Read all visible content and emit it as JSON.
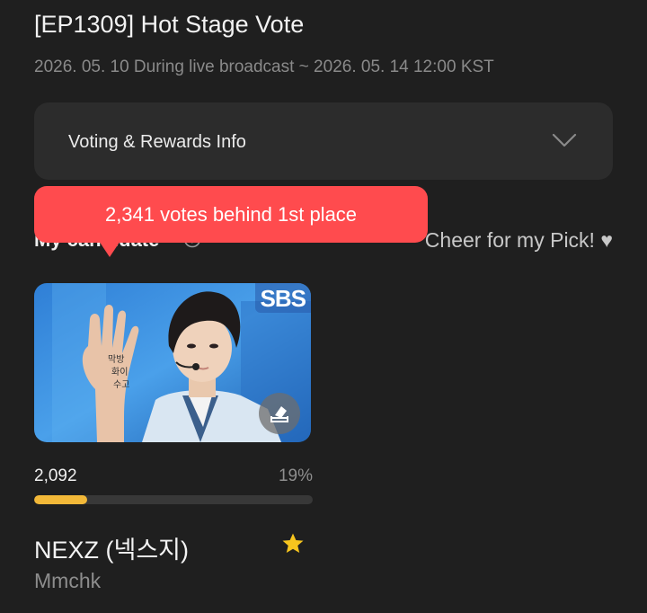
{
  "header": {
    "title": "[EP1309] Hot Stage Vote",
    "period": "2026. 05. 10 During live broadcast ~ 2026. 05. 14 12:00 KST"
  },
  "info_card": {
    "label": "Voting & Rewards Info",
    "icon": "chevron-down-icon"
  },
  "section": {
    "title": "My candidate",
    "help_icon": "question-circle-icon",
    "cheer_text": "Cheer for my Pick! ♥"
  },
  "tooltip": {
    "text": "2,341 votes behind 1st place",
    "color": "#ff4b4e"
  },
  "candidate": {
    "broadcaster_logo": "SBS",
    "votes": "2,092",
    "percent": "19%",
    "progress": 0.19,
    "progress_color": "#f2b838",
    "name": "NEXZ (넥스지)",
    "song": "Mmchk",
    "favorite_icon": "star-icon",
    "vote_icon": "ballot-box-icon"
  }
}
